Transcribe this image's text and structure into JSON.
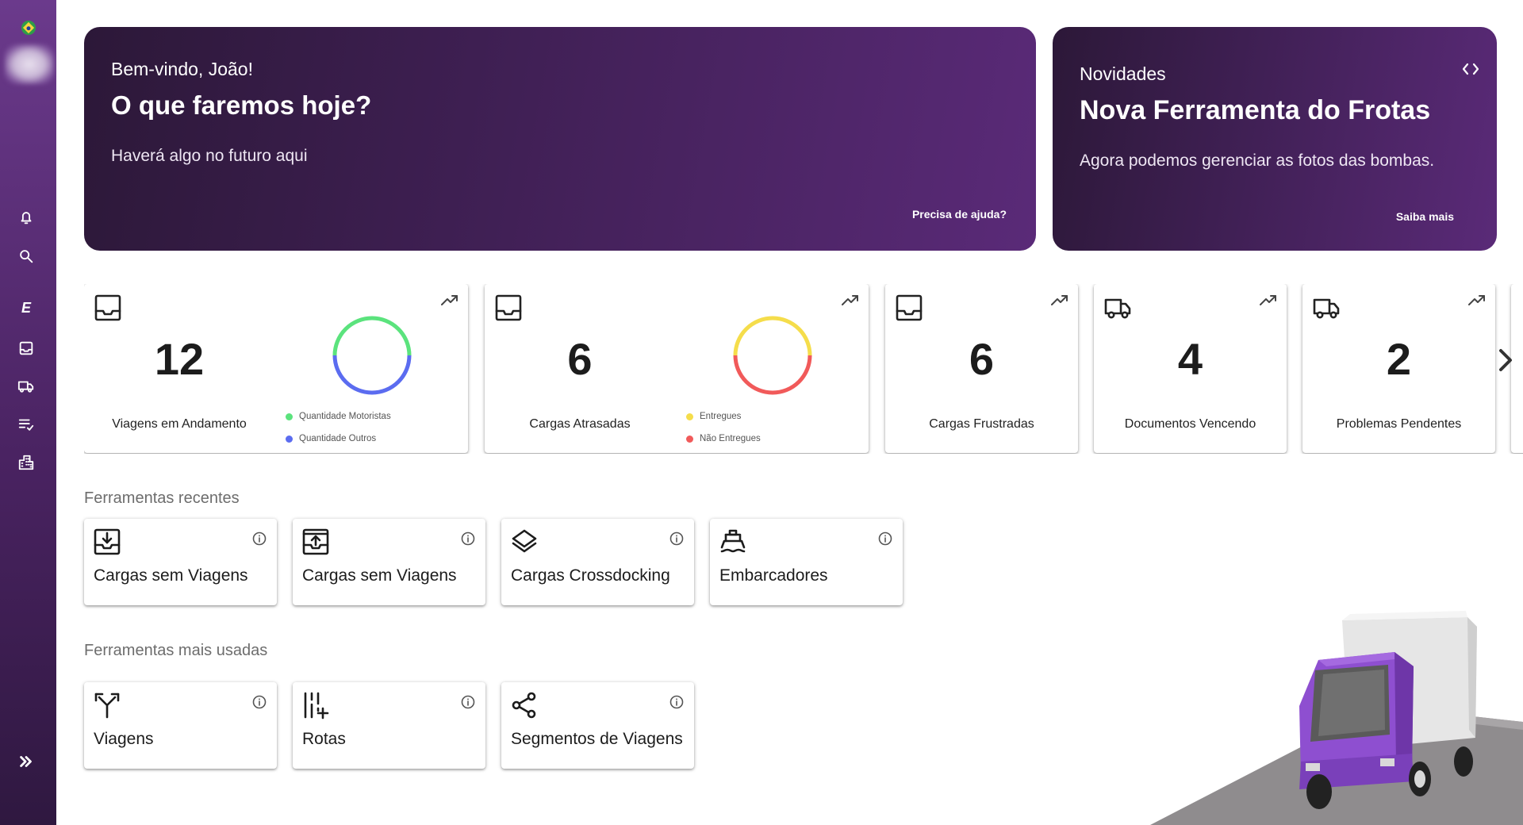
{
  "sidebar": {
    "language_flag": "brazil-flag-icon",
    "items": [
      {
        "name": "notifications",
        "icon": "bell-icon"
      },
      {
        "name": "search",
        "icon": "search-icon"
      },
      {
        "name": "letter",
        "label": "E",
        "icon": "e-letter-icon"
      },
      {
        "name": "inbox",
        "icon": "inbox-icon"
      },
      {
        "name": "fleet",
        "icon": "truck-icon"
      },
      {
        "name": "checklist",
        "icon": "checklist-icon"
      },
      {
        "name": "companies",
        "icon": "building-icon"
      }
    ],
    "expand_icon": "double-chevron-right-icon"
  },
  "welcome": {
    "greeting": "Bem-vindo, João!",
    "title": "O que faremos hoje?",
    "text": "Haverá algo no futuro aqui",
    "help_link": "Precisa de ajuda?"
  },
  "news": {
    "label": "Novidades",
    "title": "Nova Ferramenta do Frotas",
    "text": "Agora podemos gerenciar as fotos das bombas.",
    "link": "Saiba mais"
  },
  "kpis": [
    {
      "value": "12",
      "label": "Viagens em Andamento",
      "icon": "inbox-icon",
      "legend": [
        {
          "label": "Quantidade Motoristas",
          "color": "#5be37d"
        },
        {
          "label": "Quantidade Outros",
          "color": "#5b6cf0"
        }
      ]
    },
    {
      "value": "6",
      "label": "Cargas Atrasadas",
      "icon": "inbox-icon",
      "legend": [
        {
          "label": "Entregues",
          "color": "#f5dd4b"
        },
        {
          "label": "Não Entregues",
          "color": "#f15a5a"
        }
      ]
    },
    {
      "value": "6",
      "label": "Cargas Frustradas",
      "icon": "inbox-icon"
    },
    {
      "value": "4",
      "label": "Documentos Vencendo",
      "icon": "truck-icon"
    },
    {
      "value": "2",
      "label": "Problemas Pendentes",
      "icon": "truck-icon"
    }
  ],
  "recent_tools": {
    "title": "Ferramentas recentes",
    "items": [
      {
        "label": "Cargas sem Viagens",
        "icon": "inbox-download-icon"
      },
      {
        "label": "Cargas sem Viagens",
        "icon": "inbox-upload-icon"
      },
      {
        "label": "Cargas Crossdocking",
        "icon": "layers-icon"
      },
      {
        "label": "Embarcadores",
        "icon": "ship-icon"
      }
    ]
  },
  "most_used_tools": {
    "title": "Ferramentas mais usadas",
    "items": [
      {
        "label": "Viagens",
        "icon": "call-split-icon"
      },
      {
        "label": "Rotas",
        "icon": "route-tune-icon"
      },
      {
        "label": "Segmentos de Viagens",
        "icon": "share-icon"
      }
    ]
  },
  "colors": {
    "brand_purple": "#4a2362",
    "banner_dark": "#2c1838",
    "banner_light": "#5a2a78",
    "truck_purple": "#8e4fd0"
  }
}
